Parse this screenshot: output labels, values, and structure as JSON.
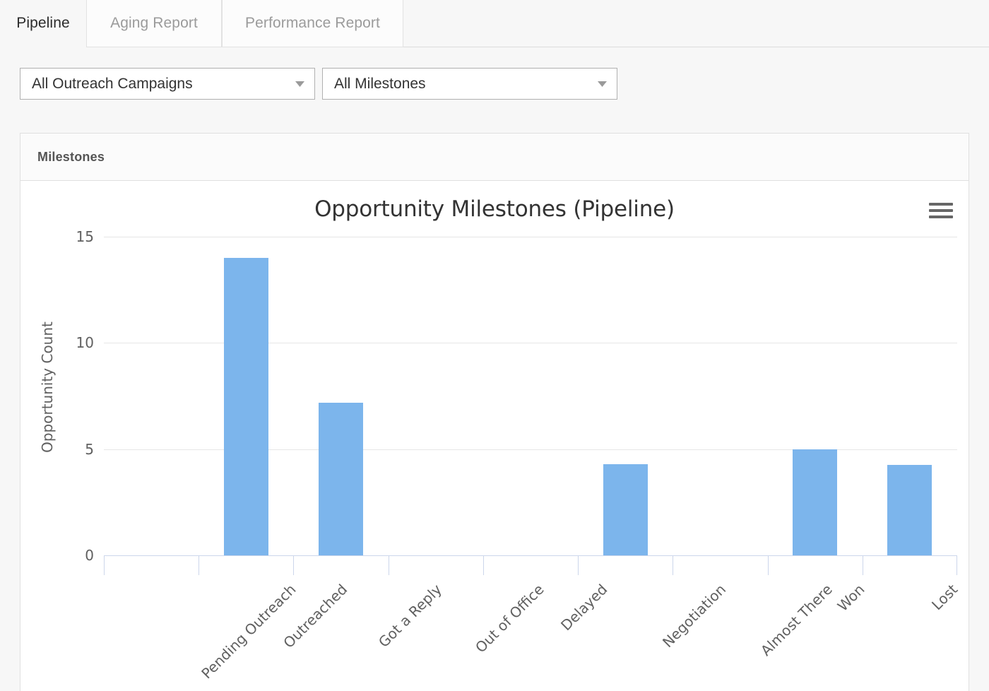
{
  "tabs": [
    {
      "label": "Pipeline",
      "active": true
    },
    {
      "label": "Aging Report",
      "active": false
    },
    {
      "label": "Performance Report",
      "active": false
    }
  ],
  "filters": [
    {
      "name": "campaign-filter",
      "value": "All Outreach Campaigns",
      "icon": "chevron-down-icon"
    },
    {
      "name": "milestone-filter",
      "value": "All Milestones",
      "icon": "chevron-down-icon"
    }
  ],
  "panel": {
    "title": "Milestones",
    "menu_icon": "hamburger-menu-icon"
  },
  "chart_data": {
    "type": "bar",
    "title": "Opportunity Milestones (Pipeline)",
    "xlabel": "",
    "ylabel": "Opportunity Count",
    "ylim": [
      0,
      15
    ],
    "yticks": [
      0,
      5,
      10,
      15
    ],
    "grid": true,
    "legend": "none",
    "series_color": "#7cb5ec",
    "categories": [
      "Pending Outreach",
      "Outreached",
      "Got a Reply",
      "Out of Office",
      "Delayed",
      "Negotiation",
      "Almost There",
      "Won",
      "Lost"
    ],
    "values": [
      0,
      14,
      7.2,
      0,
      0,
      4.3,
      0,
      5,
      4.25
    ]
  }
}
